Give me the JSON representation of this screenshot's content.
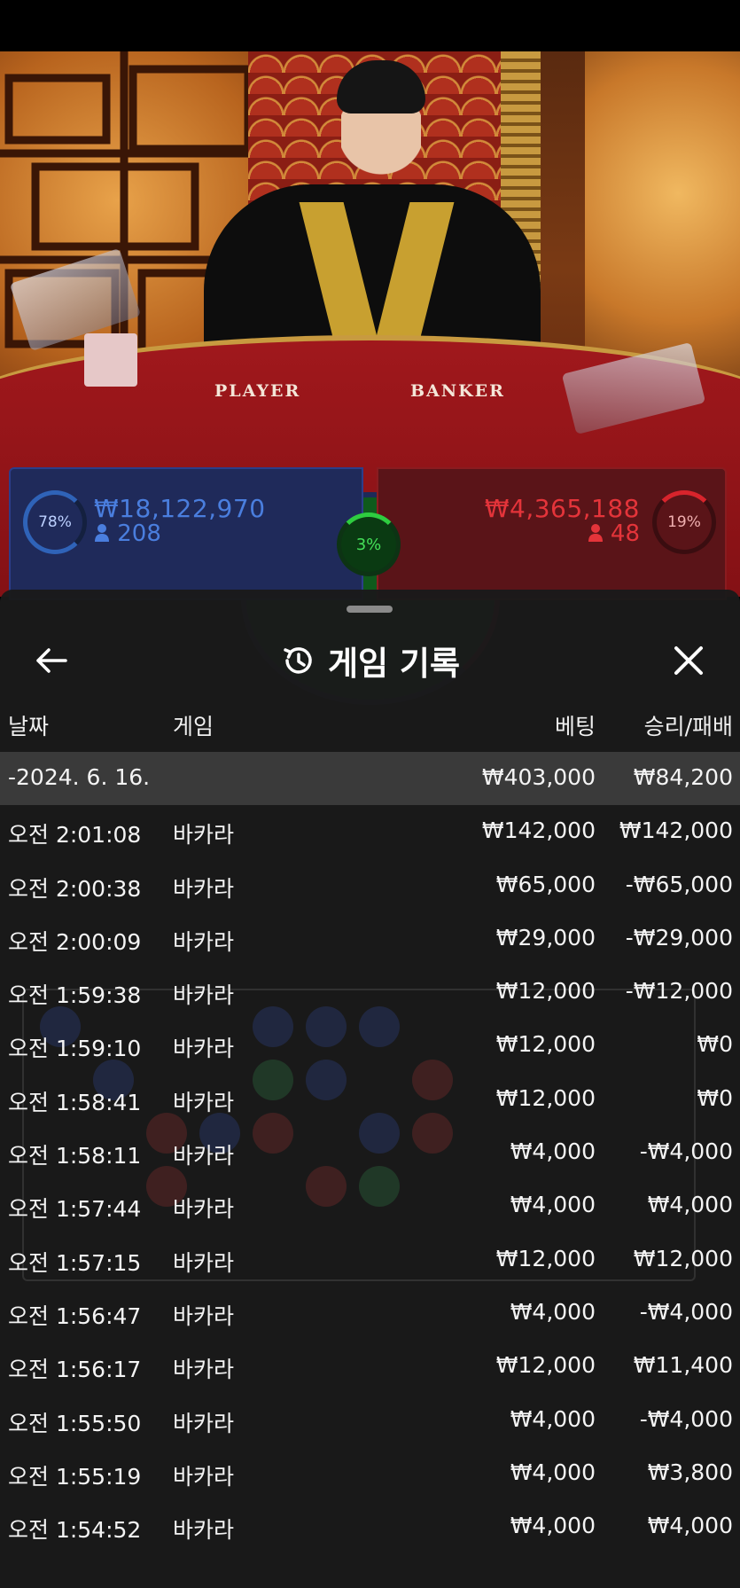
{
  "scene": {
    "table_labels": {
      "player": "PLAYER",
      "banker": "BANKER"
    }
  },
  "bets": {
    "player": {
      "percent": "78%",
      "amount": "₩18,122,970",
      "count": "208"
    },
    "tie": {
      "percent": "3%"
    },
    "banker": {
      "percent": "19%",
      "amount": "₩4,365,188",
      "count": "48"
    }
  },
  "sheet": {
    "title": "게임 기록",
    "headers": {
      "date": "날짜",
      "game": "게임",
      "bet": "베팅",
      "result": "승리/패배"
    },
    "date_row": {
      "date": "-2024. 6. 16.",
      "bet": "₩403,000",
      "result": "₩84,200"
    },
    "rows": [
      {
        "time": "오전 2:01:08",
        "game": "바카라",
        "bet": "₩142,000",
        "result": "₩142,000"
      },
      {
        "time": "오전 2:00:38",
        "game": "바카라",
        "bet": "₩65,000",
        "result": "-₩65,000"
      },
      {
        "time": "오전 2:00:09",
        "game": "바카라",
        "bet": "₩29,000",
        "result": "-₩29,000"
      },
      {
        "time": "오전 1:59:38",
        "game": "바카라",
        "bet": "₩12,000",
        "result": "-₩12,000"
      },
      {
        "time": "오전 1:59:10",
        "game": "바카라",
        "bet": "₩12,000",
        "result": "₩0"
      },
      {
        "time": "오전 1:58:41",
        "game": "바카라",
        "bet": "₩12,000",
        "result": "₩0"
      },
      {
        "time": "오전 1:58:11",
        "game": "바카라",
        "bet": "₩4,000",
        "result": "-₩4,000"
      },
      {
        "time": "오전 1:57:44",
        "game": "바카라",
        "bet": "₩4,000",
        "result": "₩4,000"
      },
      {
        "time": "오전 1:57:15",
        "game": "바카라",
        "bet": "₩12,000",
        "result": "₩12,000"
      },
      {
        "time": "오전 1:56:47",
        "game": "바카라",
        "bet": "₩4,000",
        "result": "-₩4,000"
      },
      {
        "time": "오전 1:56:17",
        "game": "바카라",
        "bet": "₩12,000",
        "result": "₩11,400"
      },
      {
        "time": "오전 1:55:50",
        "game": "바카라",
        "bet": "₩4,000",
        "result": "-₩4,000"
      },
      {
        "time": "오전 1:55:19",
        "game": "바카라",
        "bet": "₩4,000",
        "result": "₩3,800"
      },
      {
        "time": "오전 1:54:52",
        "game": "바카라",
        "bet": "₩4,000",
        "result": "₩4,000"
      }
    ]
  },
  "icons": {
    "back": "arrow-left-icon",
    "history": "history-clock-icon",
    "close": "close-icon",
    "user": "user-icon"
  }
}
